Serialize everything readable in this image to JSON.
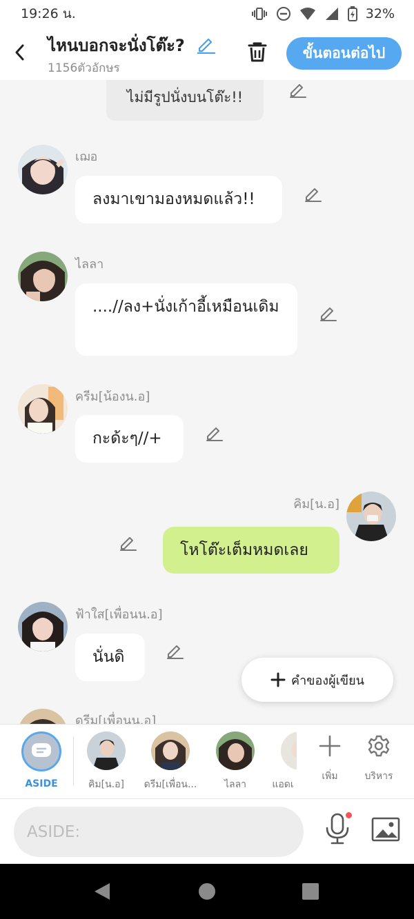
{
  "status": {
    "time": "19:26 น.",
    "battery": "32%"
  },
  "header": {
    "title": "ไหนบอกจะนั่งโต๊ะ?",
    "char_count": "1156ตัวอักษร",
    "next_label": "ขั้นตอนต่อไป"
  },
  "chat": {
    "narration": "ไม่มีรูปนั่งบนโต๊ะ!!",
    "messages": [
      {
        "speaker": "เฌอ",
        "text": "ลงมาเขามองหมดแล้ว!!",
        "side": "left"
      },
      {
        "speaker": "ไลลา",
        "text": "....//ลง+นั่งเก้าอี้เหมือนเดิม",
        "side": "left"
      },
      {
        "speaker": "ครีม[น้องน.อ]",
        "text": "กะด้ะๆ//+",
        "side": "left"
      },
      {
        "speaker": "คิม[น.อ]",
        "text": "โหโต๊ะเต็มหมดเลย",
        "side": "right"
      },
      {
        "speaker": "ฟ้าใส[เพื่อนน.อ]",
        "text": "นั่นดิ",
        "side": "left"
      },
      {
        "speaker": "ดรีม[เพื่อนน.อ]",
        "text": "",
        "side": "left"
      }
    ],
    "fab_label": "คำของผู้เขียน"
  },
  "characters": {
    "aside_label": "ASIDE",
    "items": [
      {
        "label": "คิม[น.อ]"
      },
      {
        "label": "ดรีม[เพื่อน..."
      },
      {
        "label": "ไลลา"
      },
      {
        "label": "แอดเ"
      }
    ],
    "add_label": "เพิ่ม",
    "manage_label": "บริหาร"
  },
  "input": {
    "placeholder": "ASIDE:"
  },
  "icons": {
    "back": "back-arrow-icon",
    "edit": "pencil-icon",
    "trash": "trash-icon",
    "mic": "microphone-icon",
    "image": "image-icon",
    "add": "plus-icon",
    "settings": "gear-icon"
  },
  "colors": {
    "accent": "#56a8f0",
    "my_bubble": "#d3f08f",
    "chat_bg": "#f5f5f5"
  }
}
